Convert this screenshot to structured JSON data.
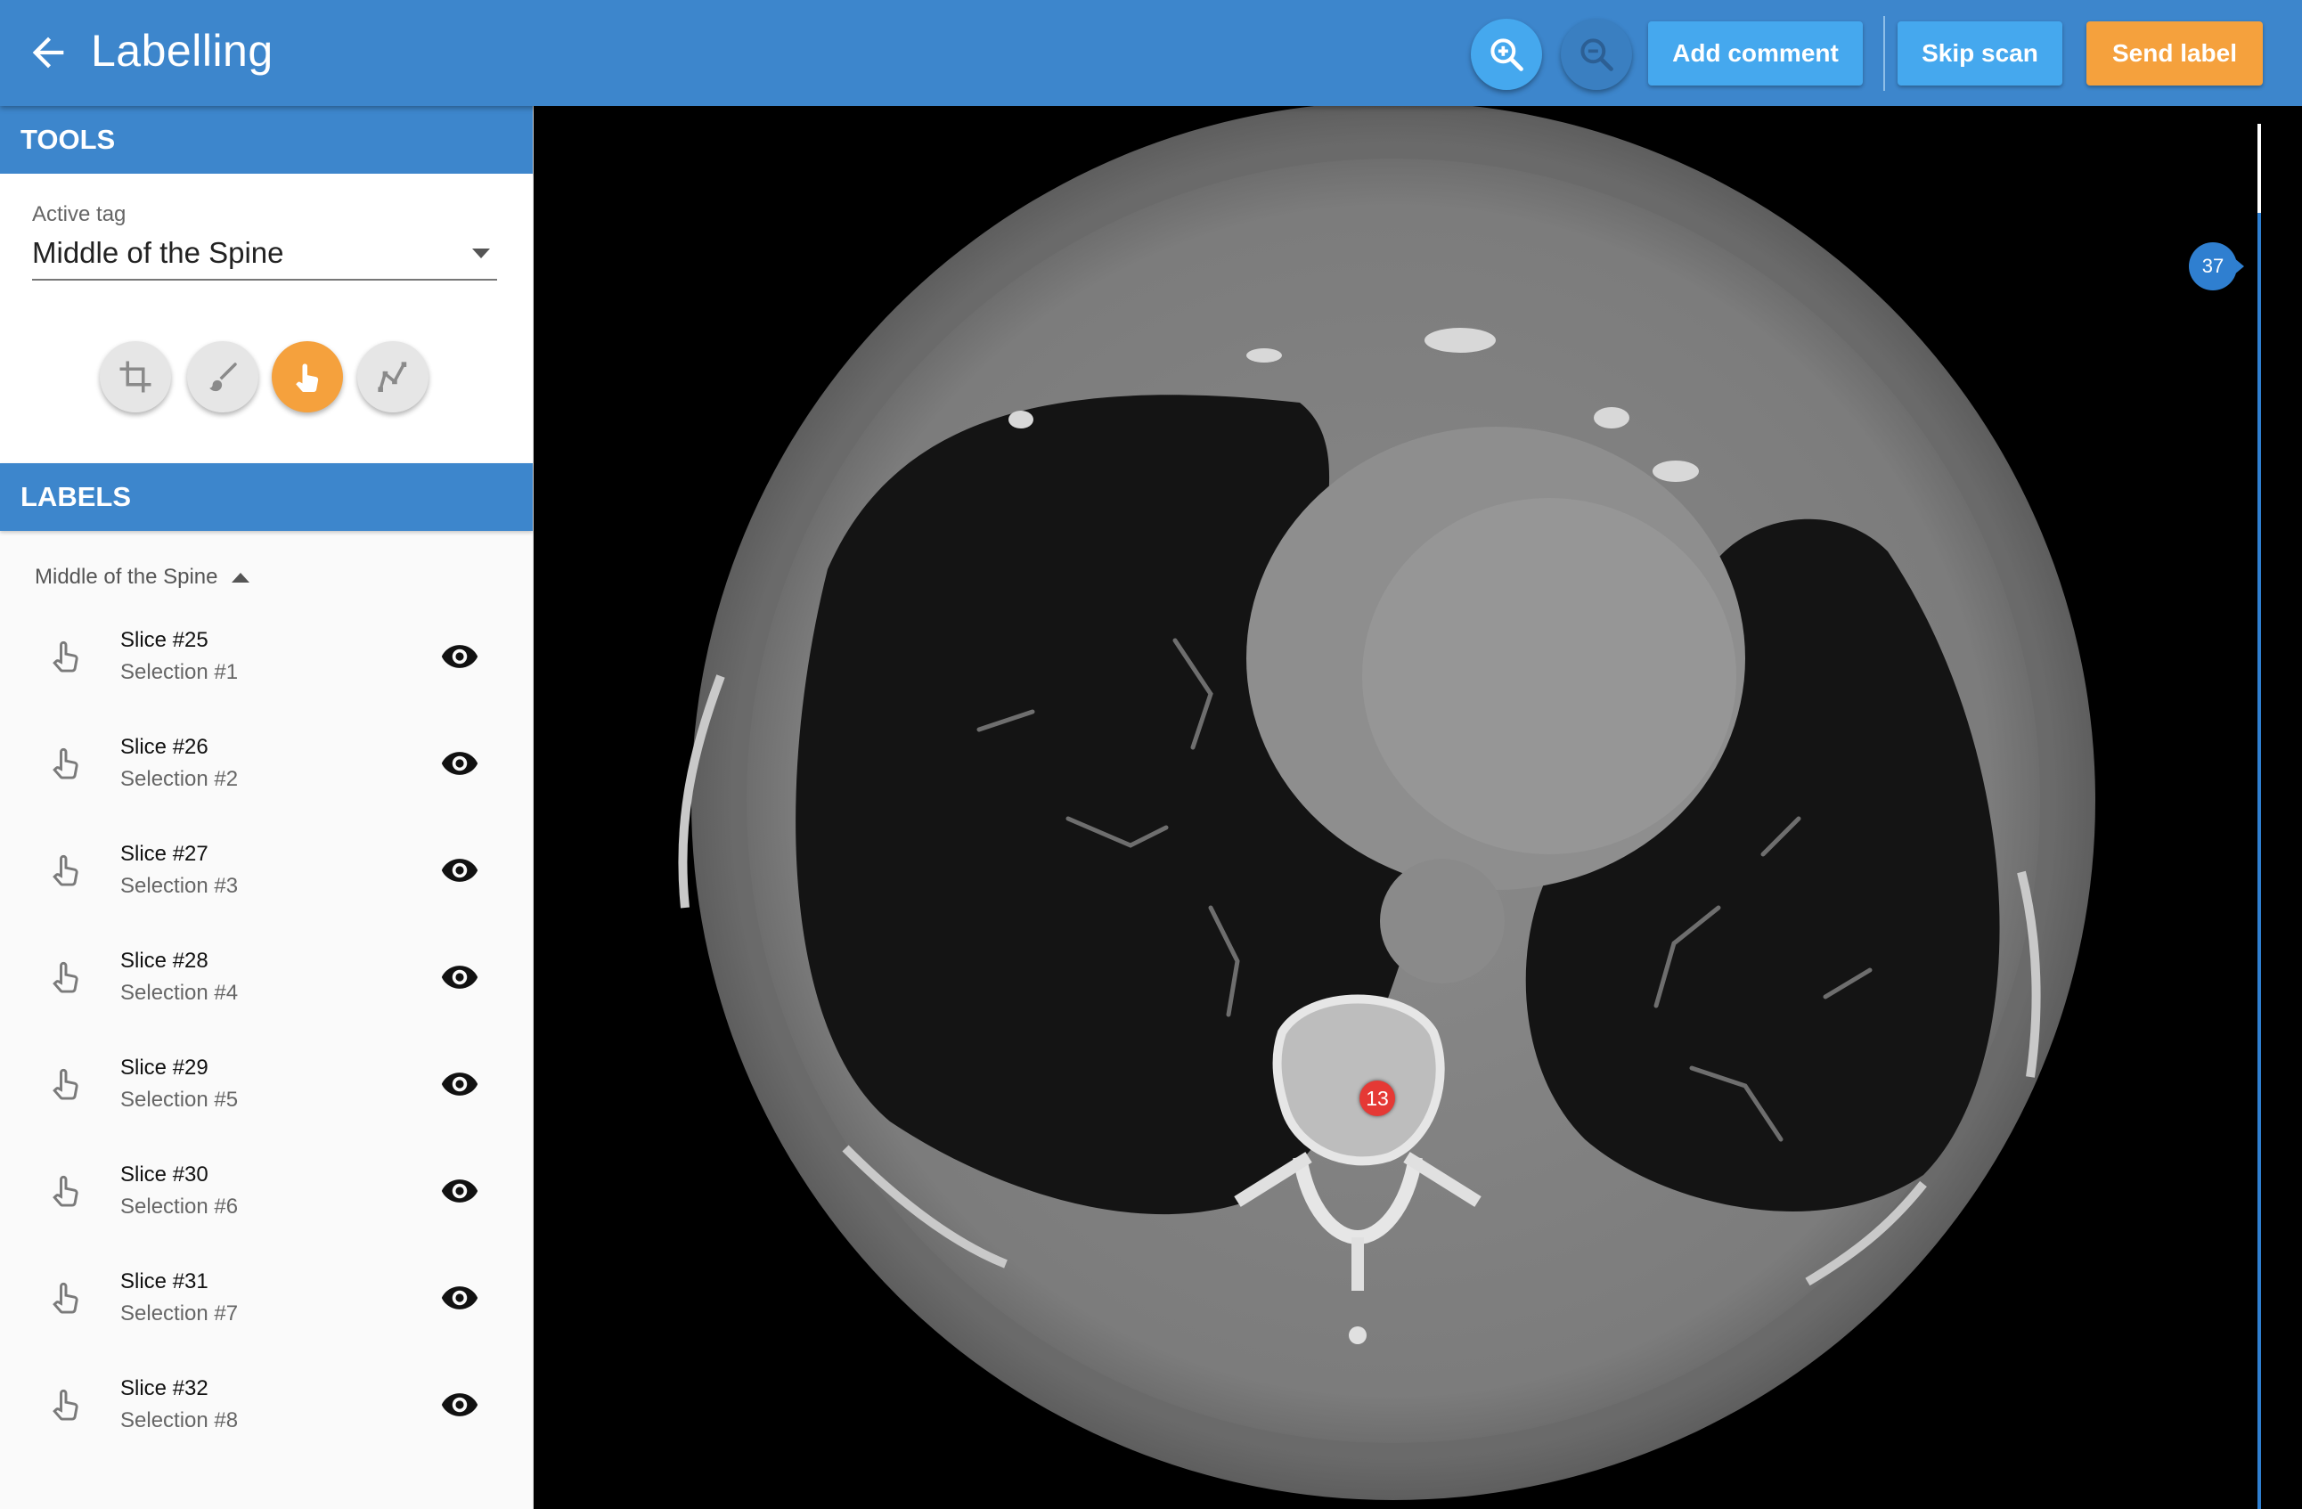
{
  "header": {
    "title": "Labelling",
    "add_comment": "Add comment",
    "skip_scan": "Skip scan",
    "send_label": "Send label"
  },
  "tools": {
    "heading": "TOOLS",
    "active_tag_label": "Active tag",
    "active_tag_value": "Middle of the Spine",
    "items": [
      {
        "icon": "crop-icon",
        "active": false
      },
      {
        "icon": "brush-icon",
        "active": false
      },
      {
        "icon": "pointer-icon",
        "active": true
      },
      {
        "icon": "polyline-icon",
        "active": false
      }
    ]
  },
  "labels": {
    "heading": "LABELS",
    "group": "Middle of the Spine",
    "items": [
      {
        "slice": "Slice #25",
        "selection": "Selection #1"
      },
      {
        "slice": "Slice #26",
        "selection": "Selection #2"
      },
      {
        "slice": "Slice #27",
        "selection": "Selection #3"
      },
      {
        "slice": "Slice #28",
        "selection": "Selection #4"
      },
      {
        "slice": "Slice #29",
        "selection": "Selection #5"
      },
      {
        "slice": "Slice #30",
        "selection": "Selection #6"
      },
      {
        "slice": "Slice #31",
        "selection": "Selection #7"
      },
      {
        "slice": "Slice #32",
        "selection": "Selection #8"
      }
    ]
  },
  "viewer": {
    "marker_label": "13",
    "current_slice": "37"
  },
  "colors": {
    "primary": "#3d86cc",
    "button": "#45a8ee",
    "accent": "#f5a13d",
    "marker": "#e53935"
  }
}
